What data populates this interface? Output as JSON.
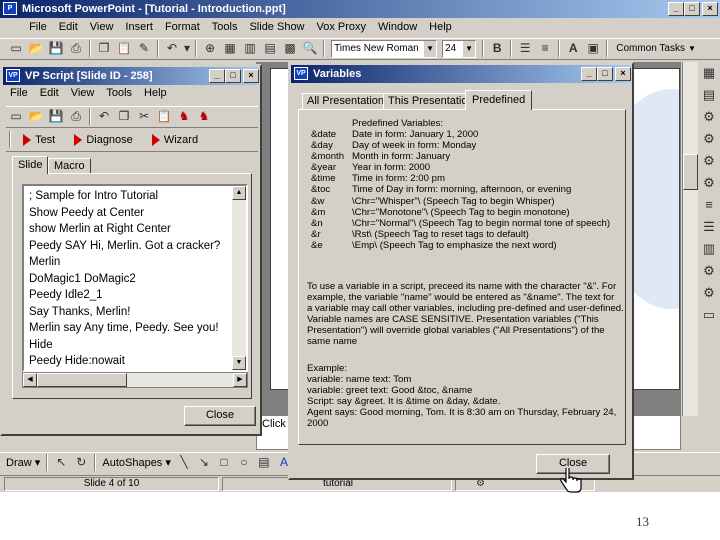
{
  "pp": {
    "title": "Microsoft PowerPoint - [Tutorial - Introduction.ppt]",
    "menu": [
      "File",
      "Edit",
      "View",
      "Insert",
      "Format",
      "Tools",
      "Slide Show",
      "Vox Proxy",
      "Window",
      "Help"
    ],
    "font_name": "Times New Roman",
    "font_size": "24",
    "common_tasks": "Common Tasks",
    "slide_hint": "Click",
    "draw_label": "Draw",
    "autoshapes_label": "AutoShapes",
    "status_slide": "Slide 4 of 10",
    "status_template": "tutorial"
  },
  "vp": {
    "title": "VP Script [Slide ID - 258]",
    "menu": [
      "File",
      "Edit",
      "View",
      "Tools",
      "Help"
    ],
    "actions": [
      "Test",
      "Diagnose",
      "Wizard"
    ],
    "tabs": [
      "Slide",
      "Macro"
    ],
    "script_lines": [
      "; Sample for Intro Tutorial",
      "Show Peedy at Center",
      "show Merlin at Right Center",
      "Peedy SAY Hi, Merlin. Got a cracker?",
      "Merlin",
      "DoMagic1 DoMagic2",
      "Peedy Idle2_1",
      "Say Thanks, Merlin!",
      "Merlin say Any time, Peedy. See you!",
      "Hide",
      "Peedy Hide:nowait"
    ],
    "close_label": "Close"
  },
  "vars": {
    "title": "Variables",
    "tabs": [
      "All Presentations",
      "This Presentation",
      "Predefined"
    ],
    "header": "Predefined Variables:",
    "rows": [
      {
        "name": "&date",
        "desc": "Date in form: January 1, 2000"
      },
      {
        "name": "&day",
        "desc": "Day of week in form: Monday"
      },
      {
        "name": "&month",
        "desc": "Month in form: January"
      },
      {
        "name": "&year",
        "desc": "Year in form: 2000"
      },
      {
        "name": "&time",
        "desc": "Time in form: 2:00 pm"
      },
      {
        "name": "&toc",
        "desc": "Time of Day in form: morning, afternoon, or evening"
      },
      {
        "name": "&w",
        "desc": "\\Chr=\"Whisper\"\\ (Speech Tag to begin Whisper)"
      },
      {
        "name": "&m",
        "desc": "\\Chr=\"Monotone\"\\ (Speech Tag to begin monotone)"
      },
      {
        "name": "&n",
        "desc": "\\Chr=\"Normal\"\\ (Speech Tag to begin normal tone of speech)"
      },
      {
        "name": "&r",
        "desc": "\\Rst\\ (Speech Tag to reset tags to default)"
      },
      {
        "name": "&e",
        "desc": "\\Emp\\ (Speech Tag to emphasize the next word)"
      }
    ],
    "paragraph": [
      "To use a variable in a script, preceed its name with the character \"&\". For",
      "example, the variable \"name\" would be entered as \"&name\". The text for",
      "a variable may call other variables, including pre-defined and user-defined.",
      "Variable names are CASE SENSITIVE. Presentation variables (\"This",
      "Presentation\") will override global variables (\"All Presentations\") of the",
      "same name"
    ],
    "example": [
      "Example:",
      "variable: name      text: Tom",
      "variable: greet     text: Good &toc, &name",
      "Script: say &greet. It is &time on &day, &date.",
      "Agent says: Good morning, Tom. It is 8:30 am on Thursday, February 24,",
      "2000"
    ],
    "close_label": "Close"
  },
  "page_number": "13"
}
